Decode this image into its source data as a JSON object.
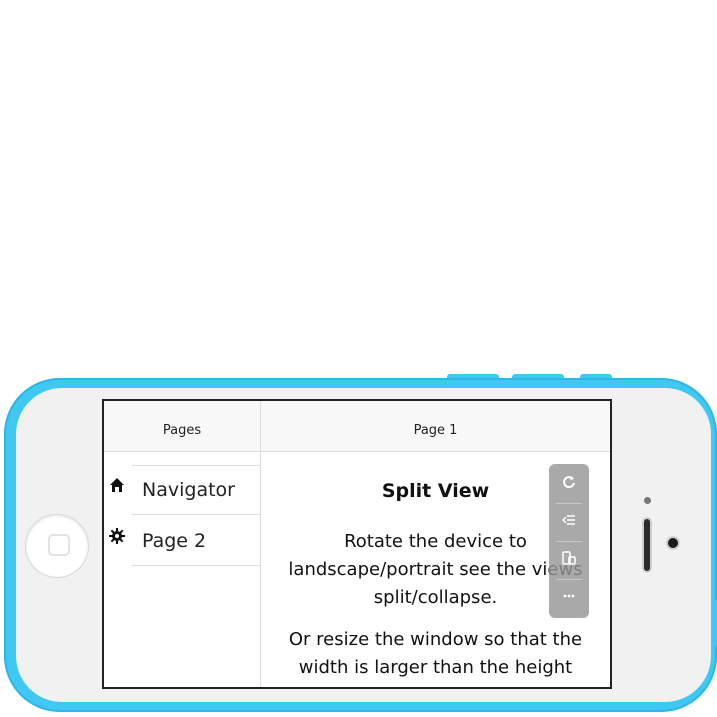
{
  "left_pane": {
    "title": "Pages",
    "items": [
      {
        "label": "Navigator",
        "icon": "home-icon"
      },
      {
        "label": "Page 2",
        "icon": "gear-icon"
      }
    ]
  },
  "main": {
    "title": "Page 1",
    "heading": "Split View",
    "paragraph1": "Rotate the device to landscape/portrait see the views split/collapse.",
    "paragraph2": "Or resize the window so that the width is larger than the height"
  },
  "toolpanel": {
    "items": [
      "refresh-icon",
      "list-icon",
      "devices-icon",
      "more-icon"
    ]
  },
  "colors": {
    "phone_body": "#3ec8f2",
    "phone_face": "#f1f1f1",
    "screen_bg": "#ffffff"
  }
}
